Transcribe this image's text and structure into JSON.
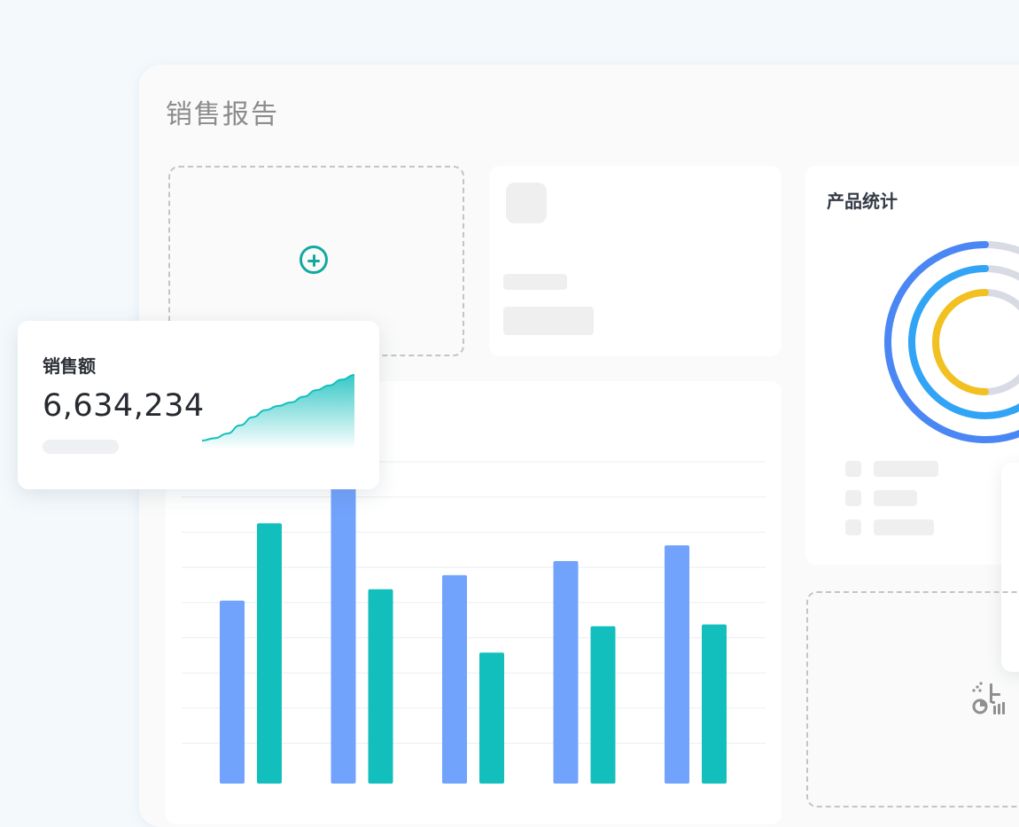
{
  "report": {
    "title": "销售报告"
  },
  "product_stats": {
    "title": "产品统计"
  },
  "sales": {
    "label": "销售额",
    "value": "6,634,234"
  },
  "colors": {
    "teal": "#13bfbd",
    "blue": "#71a2fc",
    "ring_outer": "#4a87f4",
    "ring_middle": "#32a4f6",
    "ring_inner": "#f2c121",
    "ring_track": "#d9dbe4"
  },
  "icons": [
    "plus-circle-icon",
    "chart-tools-icon"
  ],
  "chart_data": [
    {
      "type": "bar",
      "categories": [
        "",
        "",
        "",
        "",
        ""
      ],
      "series": [
        {
          "values": [
            202,
            330,
            231,
            247,
            265
          ]
        },
        {
          "values": [
            290,
            215,
            143,
            173,
            175
          ]
        }
      ],
      "ylim": [
        0,
        360
      ],
      "grid": true
    },
    {
      "type": "area",
      "values": [
        0,
        4,
        12,
        26,
        40,
        52,
        59,
        65,
        75,
        86,
        94,
        104,
        112
      ]
    },
    {
      "type": "pie",
      "series": [
        {
          "value": 0.66
        },
        {
          "value": 0.6
        },
        {
          "value": 0.5
        }
      ]
    }
  ]
}
